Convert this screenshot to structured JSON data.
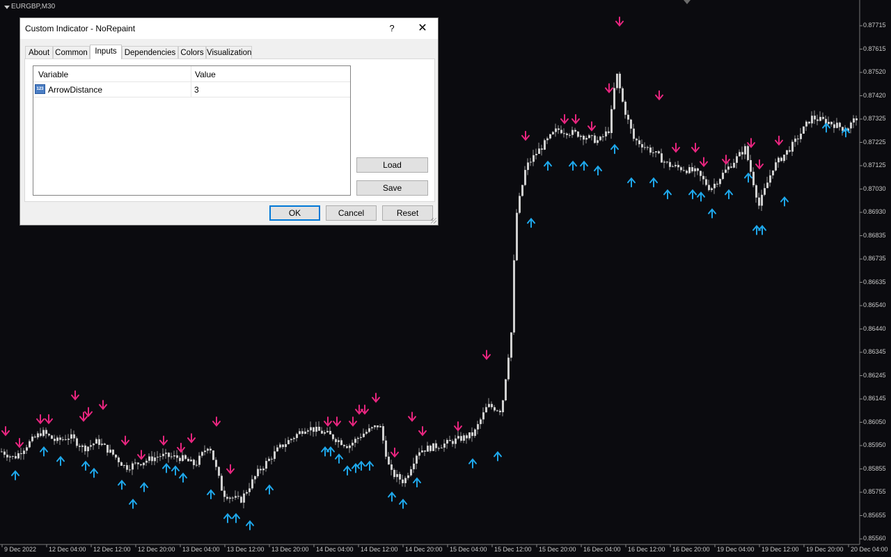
{
  "chart": {
    "symbol": "EURGBP,M30",
    "price_labels": [
      "0.87715",
      "0.87615",
      "0.87520",
      "0.87420",
      "0.87325",
      "0.87225",
      "0.87125",
      "0.87030",
      "0.86930",
      "0.86835",
      "0.86735",
      "0.86635",
      "0.86540",
      "0.86440",
      "0.86345",
      "0.86245",
      "0.86145",
      "0.86050",
      "0.85950",
      "0.85855",
      "0.85755",
      "0.85655",
      "0.85560"
    ],
    "time_labels": [
      "9 Dec 2022",
      "12 Dec 04:00",
      "12 Dec 12:00",
      "12 Dec 20:00",
      "13 Dec 04:00",
      "13 Dec 12:00",
      "13 Dec 20:00",
      "14 Dec 04:00",
      "14 Dec 12:00",
      "14 Dec 20:00",
      "15 Dec 04:00",
      "15 Dec 12:00",
      "15 Dec 20:00",
      "16 Dec 04:00",
      "16 Dec 12:00",
      "16 Dec 20:00",
      "19 Dec 04:00",
      "19 Dec 12:00",
      "19 Dec 20:00",
      "20 Dec 04:00"
    ],
    "colors": {
      "background": "#0b0b0f",
      "candle": "#d0d0d0",
      "wick": "#9a9a9a",
      "down_arrow": "#e8257f",
      "up_arrow": "#1ea7ea"
    },
    "price_trend": [
      [
        0,
        0.8593
      ],
      [
        20,
        0.859
      ],
      [
        40,
        0.8596
      ],
      [
        60,
        0.8601
      ],
      [
        80,
        0.8597
      ],
      [
        100,
        0.8599
      ],
      [
        120,
        0.8594
      ],
      [
        140,
        0.8597
      ],
      [
        160,
        0.8592
      ],
      [
        180,
        0.8586
      ],
      [
        200,
        0.8588
      ],
      [
        230,
        0.8591
      ],
      [
        260,
        0.859
      ],
      [
        280,
        0.8587
      ],
      [
        300,
        0.8596
      ],
      [
        320,
        0.8575
      ],
      [
        345,
        0.8572
      ],
      [
        370,
        0.8584
      ],
      [
        400,
        0.8594
      ],
      [
        440,
        0.8603
      ],
      [
        470,
        0.86
      ],
      [
        500,
        0.8595
      ],
      [
        520,
        0.86
      ],
      [
        545,
        0.8604
      ],
      [
        560,
        0.8584
      ],
      [
        580,
        0.858
      ],
      [
        600,
        0.8593
      ],
      [
        640,
        0.8596
      ],
      [
        680,
        0.86
      ],
      [
        700,
        0.8612
      ],
      [
        720,
        0.861
      ],
      [
        735,
        0.8645
      ],
      [
        740,
        0.869
      ],
      [
        755,
        0.8712
      ],
      [
        770,
        0.8718
      ],
      [
        800,
        0.8728
      ],
      [
        830,
        0.8726
      ],
      [
        860,
        0.8723
      ],
      [
        875,
        0.8728
      ],
      [
        885,
        0.8752
      ],
      [
        895,
        0.8738
      ],
      [
        910,
        0.8724
      ],
      [
        940,
        0.8718
      ],
      [
        960,
        0.8713
      ],
      [
        1000,
        0.871
      ],
      [
        1020,
        0.8703
      ],
      [
        1040,
        0.871
      ],
      [
        1070,
        0.872
      ],
      [
        1090,
        0.8696
      ],
      [
        1110,
        0.8712
      ],
      [
        1140,
        0.8722
      ],
      [
        1165,
        0.8733
      ],
      [
        1190,
        0.8731
      ],
      [
        1215,
        0.8728
      ],
      [
        1230,
        0.8733
      ]
    ],
    "down_arrows": [
      [
        8,
        0.8599
      ],
      [
        28,
        0.8594
      ],
      [
        58,
        0.8604
      ],
      [
        70,
        0.8604
      ],
      [
        108,
        0.8614
      ],
      [
        120,
        0.8605
      ],
      [
        127,
        0.8607
      ],
      [
        148,
        0.861
      ],
      [
        180,
        0.8595
      ],
      [
        203,
        0.8589
      ],
      [
        235,
        0.8595
      ],
      [
        260,
        0.8592
      ],
      [
        275,
        0.8596
      ],
      [
        311,
        0.8603
      ],
      [
        331,
        0.8583
      ],
      [
        471,
        0.8603
      ],
      [
        484,
        0.8603
      ],
      [
        507,
        0.8603
      ],
      [
        516,
        0.8608
      ],
      [
        524,
        0.8608
      ],
      [
        540,
        0.8613
      ],
      [
        567,
        0.859
      ],
      [
        592,
        0.8605
      ],
      [
        607,
        0.8599
      ],
      [
        658,
        0.8601
      ],
      [
        699,
        0.8631
      ],
      [
        755,
        0.8723
      ],
      [
        811,
        0.873
      ],
      [
        827,
        0.873
      ],
      [
        850,
        0.8727
      ],
      [
        875,
        0.8743
      ],
      [
        890,
        0.8771
      ],
      [
        947,
        0.874
      ],
      [
        971,
        0.8718
      ],
      [
        999,
        0.8718
      ],
      [
        1011,
        0.8712
      ],
      [
        1043,
        0.8713
      ],
      [
        1079,
        0.872
      ],
      [
        1091,
        0.8711
      ],
      [
        1119,
        0.8721
      ]
    ],
    "up_arrows": [
      [
        22,
        0.8585
      ],
      [
        63,
        0.8595
      ],
      [
        87,
        0.8591
      ],
      [
        123,
        0.8589
      ],
      [
        135,
        0.8586
      ],
      [
        175,
        0.8581
      ],
      [
        191,
        0.8573
      ],
      [
        207,
        0.858
      ],
      [
        239,
        0.8588
      ],
      [
        252,
        0.8587
      ],
      [
        263,
        0.8584
      ],
      [
        303,
        0.8577
      ],
      [
        327,
        0.8567
      ],
      [
        339,
        0.8567
      ],
      [
        359,
        0.8564
      ],
      [
        387,
        0.8579
      ],
      [
        467,
        0.8595
      ],
      [
        475,
        0.8595
      ],
      [
        487,
        0.8592
      ],
      [
        499,
        0.8587
      ],
      [
        511,
        0.8588
      ],
      [
        519,
        0.8589
      ],
      [
        531,
        0.8589
      ],
      [
        563,
        0.8576
      ],
      [
        579,
        0.8573
      ],
      [
        599,
        0.8582
      ],
      [
        679,
        0.859
      ],
      [
        715,
        0.8593
      ],
      [
        763,
        0.8691
      ],
      [
        787,
        0.8715
      ],
      [
        823,
        0.8715
      ],
      [
        839,
        0.8715
      ],
      [
        859,
        0.8713
      ],
      [
        883,
        0.8722
      ],
      [
        907,
        0.8708
      ],
      [
        939,
        0.8708
      ],
      [
        959,
        0.8703
      ],
      [
        995,
        0.8703
      ],
      [
        1007,
        0.8702
      ],
      [
        1023,
        0.8695
      ],
      [
        1047,
        0.8703
      ],
      [
        1075,
        0.871
      ],
      [
        1087,
        0.8688
      ],
      [
        1095,
        0.8688
      ],
      [
        1127,
        0.87
      ],
      [
        1187,
        0.8731
      ],
      [
        1215,
        0.8729
      ]
    ]
  },
  "dialog": {
    "title": "Custom Indicator - NoRepaint",
    "help_glyph": "?",
    "close_glyph": "✕",
    "tabs": [
      "About",
      "Common",
      "Inputs",
      "Dependencies",
      "Colors",
      "Visualization"
    ],
    "active_tab": "Inputs",
    "grid": {
      "header_variable": "Variable",
      "header_value": "Value",
      "rows": [
        {
          "icon_text": "123",
          "name": "ArrowDistance",
          "value": "3"
        }
      ]
    },
    "buttons": {
      "load": "Load",
      "save": "Save",
      "ok": "OK",
      "cancel": "Cancel",
      "reset": "Reset"
    }
  }
}
